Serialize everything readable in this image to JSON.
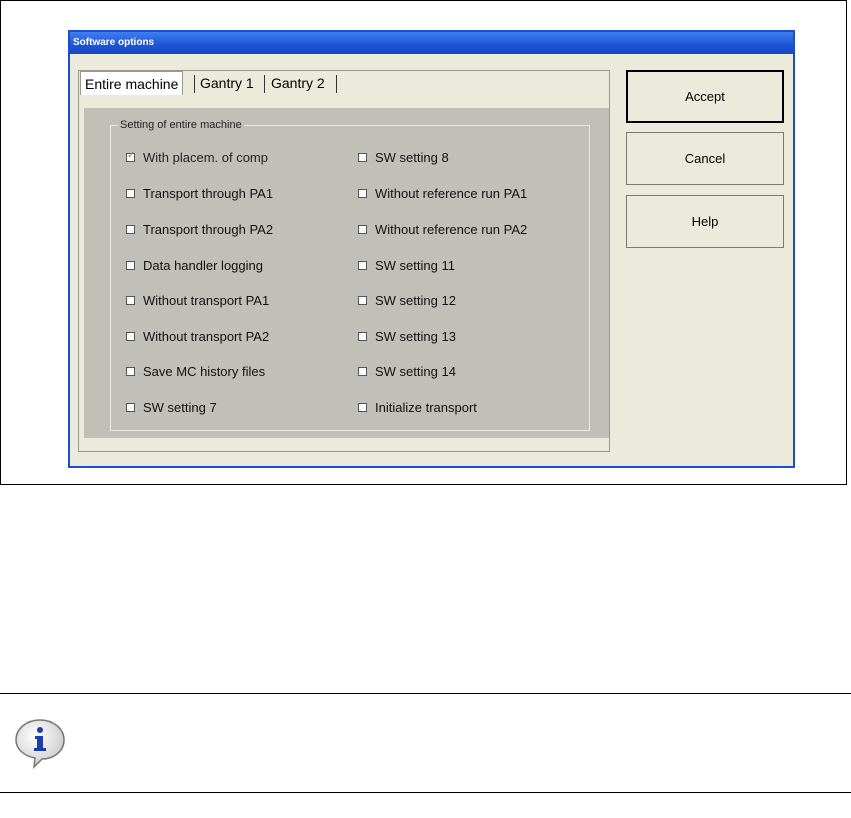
{
  "window": {
    "title": "Software options"
  },
  "tabs": [
    {
      "label": "Entire machine",
      "active": true
    },
    {
      "label": "Gantry 1",
      "active": false
    },
    {
      "label": "Gantry 2",
      "active": false
    }
  ],
  "group": {
    "label": "Setting of entire machine"
  },
  "options_left": [
    {
      "label": "With placem. of comp",
      "checked": true
    },
    {
      "label": "Transport through PA1",
      "checked": false
    },
    {
      "label": "Transport through PA2",
      "checked": false
    },
    {
      "label": "Data handler logging",
      "checked": false
    },
    {
      "label": "Without transport PA1",
      "checked": false
    },
    {
      "label": "Without transport PA2",
      "checked": false
    },
    {
      "label": "Save MC history files",
      "checked": false
    },
    {
      "label": "SW setting 7",
      "checked": false
    }
  ],
  "options_right": [
    {
      "label": "SW setting 8",
      "checked": false
    },
    {
      "label": "Without reference run PA1",
      "checked": false
    },
    {
      "label": "Without reference run PA2",
      "checked": false
    },
    {
      "label": "SW setting 11",
      "checked": false
    },
    {
      "label": "SW setting 12",
      "checked": false
    },
    {
      "label": "SW setting 13",
      "checked": false
    },
    {
      "label": "SW setting 14",
      "checked": false
    },
    {
      "label": "Initialize transport",
      "checked": false
    }
  ],
  "buttons": {
    "accept": "Accept",
    "cancel": "Cancel",
    "help": "Help"
  },
  "icons": {
    "info": "info-icon"
  },
  "colors": {
    "titlebar": "#1d54d6",
    "panel": "#c1c0b8",
    "window_bg": "#ecebdb"
  }
}
